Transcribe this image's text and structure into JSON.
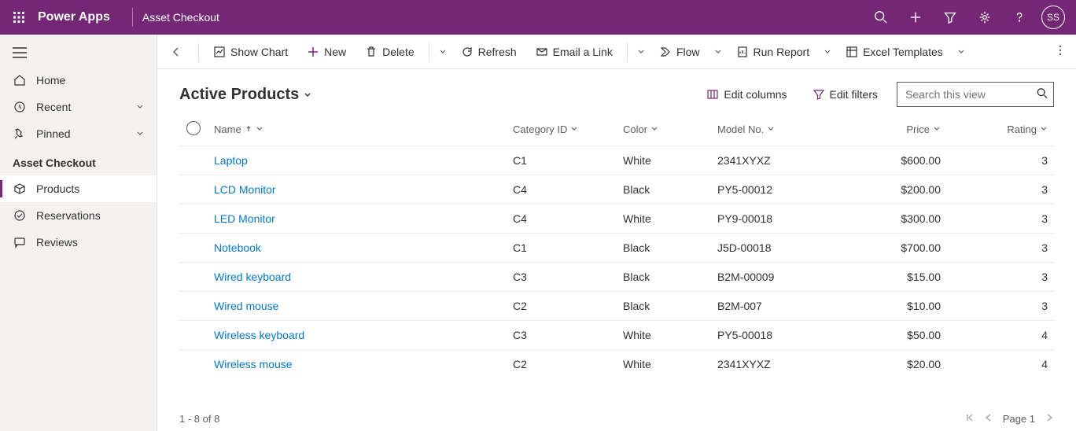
{
  "header": {
    "app_name": "Power Apps",
    "page_name": "Asset Checkout",
    "avatar_initials": "SS"
  },
  "sidebar": {
    "nav": [
      {
        "label": "Home"
      },
      {
        "label": "Recent"
      },
      {
        "label": "Pinned"
      }
    ],
    "section_label": "Asset Checkout",
    "items": [
      {
        "label": "Products"
      },
      {
        "label": "Reservations"
      },
      {
        "label": "Reviews"
      }
    ]
  },
  "cmdbar": {
    "show_chart": "Show Chart",
    "new": "New",
    "delete": "Delete",
    "refresh": "Refresh",
    "email_link": "Email a Link",
    "flow": "Flow",
    "run_report": "Run Report",
    "excel_templates": "Excel Templates"
  },
  "view": {
    "title": "Active Products",
    "edit_columns": "Edit columns",
    "edit_filters": "Edit filters",
    "search_placeholder": "Search this view"
  },
  "table": {
    "headers": {
      "name": "Name",
      "category": "Category ID",
      "color": "Color",
      "model": "Model No.",
      "price": "Price",
      "rating": "Rating"
    },
    "rows": [
      {
        "name": "Laptop",
        "category": "C1",
        "color": "White",
        "model": "2341XYXZ",
        "price": "$600.00",
        "rating": "3"
      },
      {
        "name": "LCD Monitor",
        "category": "C4",
        "color": "Black",
        "model": "PY5-00012",
        "price": "$200.00",
        "rating": "3"
      },
      {
        "name": "LED Monitor",
        "category": "C4",
        "color": "White",
        "model": "PY9-00018",
        "price": "$300.00",
        "rating": "3"
      },
      {
        "name": "Notebook",
        "category": "C1",
        "color": "Black",
        "model": "J5D-00018",
        "price": "$700.00",
        "rating": "3"
      },
      {
        "name": "Wired keyboard",
        "category": "C3",
        "color": "Black",
        "model": "B2M-00009",
        "price": "$15.00",
        "rating": "3"
      },
      {
        "name": "Wired mouse",
        "category": "C2",
        "color": "Black",
        "model": "B2M-007",
        "price": "$10.00",
        "rating": "3"
      },
      {
        "name": "Wireless keyboard",
        "category": "C3",
        "color": "White",
        "model": "PY5-00018",
        "price": "$50.00",
        "rating": "4"
      },
      {
        "name": "Wireless mouse",
        "category": "C2",
        "color": "White",
        "model": "2341XYXZ",
        "price": "$20.00",
        "rating": "4"
      }
    ]
  },
  "footer": {
    "range": "1 - 8 of 8",
    "page_label": "Page 1"
  }
}
